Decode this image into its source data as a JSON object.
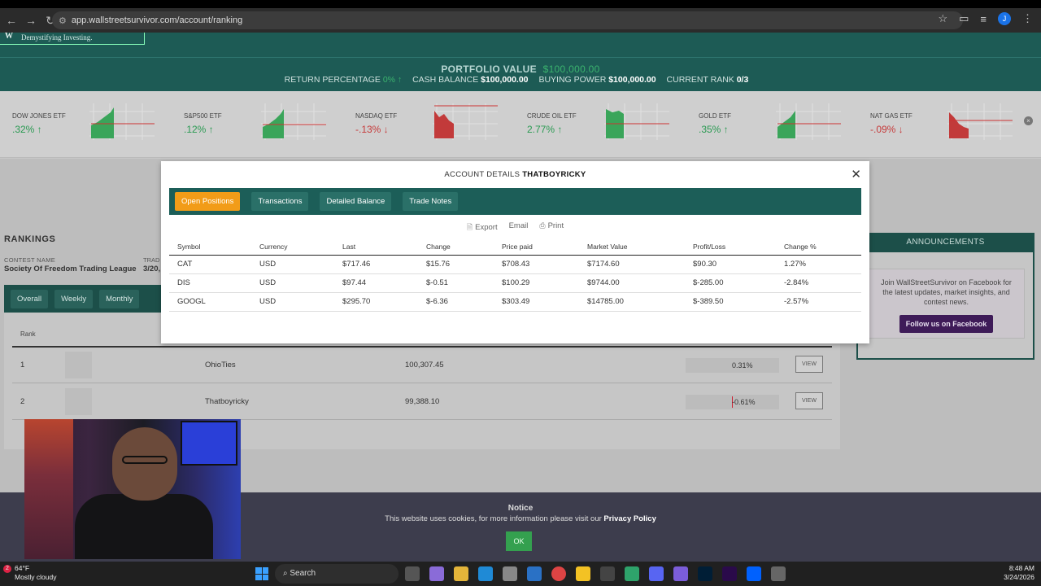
{
  "browser": {
    "url": "app.wallstreetsurvivor.com/account/ranking",
    "profile_initial": "J"
  },
  "header": {
    "tagline": "Demystifying Investing.",
    "portfolio_value_label": "PORTFOLIO VALUE",
    "portfolio_value": "$100,000.00",
    "return_label": "RETURN PERCENTAGE",
    "return_value": "0% ↑",
    "cash_label": "CASH BALANCE",
    "cash_value": "$100,000.00",
    "buying_label": "BUYING POWER",
    "buying_value": "$100,000.00",
    "rank_label": "CURRENT RANK",
    "rank_value": "0/3"
  },
  "tickers": [
    {
      "name": "DOW JONES ETF",
      "pct": ".32% ↑",
      "dir": "up"
    },
    {
      "name": "S&P500 ETF",
      "pct": ".12% ↑",
      "dir": "up"
    },
    {
      "name": "NASDAQ ETF",
      "pct": "-.13% ↓",
      "dir": "down"
    },
    {
      "name": "CRUDE OIL ETF",
      "pct": "2.77% ↑",
      "dir": "up"
    },
    {
      "name": "GOLD ETF",
      "pct": ".35% ↑",
      "dir": "up"
    },
    {
      "name": "NAT GAS ETF",
      "pct": "-.09% ↓",
      "dir": "down"
    }
  ],
  "rankings": {
    "title": "RANKINGS",
    "contest_label": "CONTEST NAME",
    "contest_name": "Society Of Freedom Trading League",
    "trade_label": "TRAD",
    "trade_value": "3/20,",
    "tabs": [
      "Overall",
      "Weekly",
      "Monthly"
    ],
    "rank_header": "Rank",
    "rows": [
      {
        "rank": "1",
        "user": "OhioTies",
        "value": "100,307.45",
        "pct": "0.31%",
        "view": "VIEW"
      },
      {
        "rank": "2",
        "user": "Thatboyricky",
        "value": "99,388.10",
        "pct": "-0.61%",
        "view": "VIEW"
      }
    ]
  },
  "announcements": {
    "title": "ANNOUNCEMENTS",
    "text": "Join WallStreetSurvivor on Facebook for the latest updates, market insights, and contest news.",
    "button": "Follow us on Facebook"
  },
  "modal": {
    "title_prefix": "ACCOUNT DETAILS",
    "username": "THATBOYRICKY",
    "tabs": [
      "Open Positions",
      "Transactions",
      "Detailed Balance",
      "Trade Notes"
    ],
    "active_tab": "Open Positions",
    "actions": [
      "Export",
      "Email",
      "Print"
    ],
    "columns": [
      "Symbol",
      "Currency",
      "Last",
      "Change",
      "Price paid",
      "Market Value",
      "Profit/Loss",
      "Change %"
    ],
    "positions": [
      [
        "CAT",
        "USD",
        "$717.46",
        "$15.76",
        "$708.43",
        "$7174.60",
        "$90.30",
        "1.27%"
      ],
      [
        "DIS",
        "USD",
        "$97.44",
        "$-0.51",
        "$100.29",
        "$9744.00",
        "$-285.00",
        "-2.84%"
      ],
      [
        "GOOGL",
        "USD",
        "$295.70",
        "$-6.36",
        "$303.49",
        "$14785.00",
        "$-389.50",
        "-2.57%"
      ]
    ]
  },
  "notice": {
    "title": "Notice",
    "text": "This website uses cookies, for more information please visit our",
    "link": "Privacy Policy",
    "ok": "OK"
  },
  "taskbar": {
    "weather_badge": "2",
    "temp": "64°F",
    "condition": "Mostly cloudy",
    "search": "Search",
    "time": "8:48 AM",
    "date": "3/24/2026"
  }
}
